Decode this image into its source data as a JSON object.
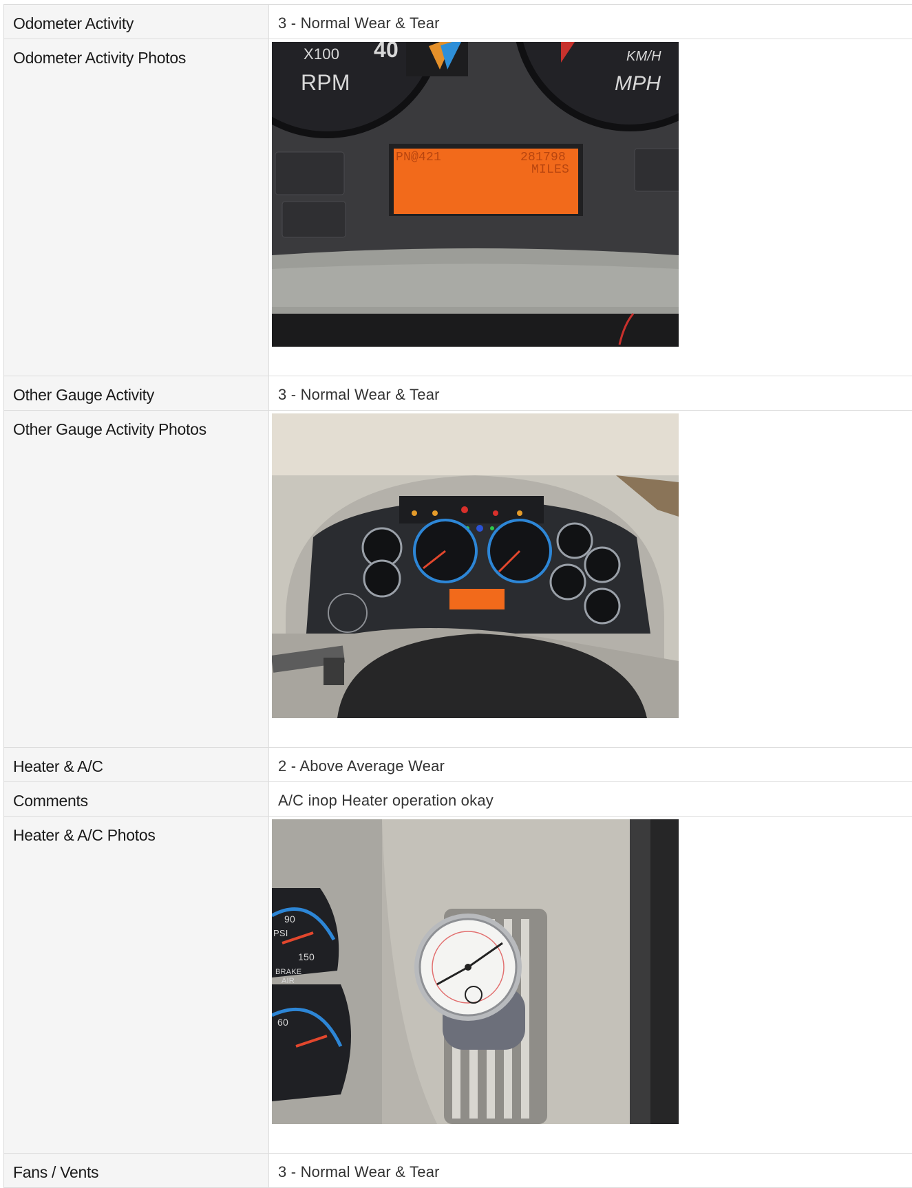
{
  "rows": [
    {
      "label": "Odometer Activity",
      "value": "3 - Normal Wear & Tear"
    },
    {
      "label": "Odometer Activity Photos",
      "photo": {
        "description_icon": "odometer-photo",
        "texts": {
          "x100": "X100",
          "rpm": "RPM",
          "forty": "40",
          "kmh": "KM/H",
          "mph": "MPH",
          "lcd_left": "PN@421",
          "lcd_right": "281798",
          "lcd_unit": "MILES"
        }
      }
    },
    {
      "label": "Other Gauge Activity",
      "value": "3 - Normal Wear & Tear"
    },
    {
      "label": "Other Gauge Activity Photos",
      "photo": {
        "description_icon": "gauge-cluster-photo"
      }
    },
    {
      "label": "Heater & A/C",
      "value": "2 - Above Average Wear"
    },
    {
      "label": "Comments",
      "value": "A/C inop Heater operation okay"
    },
    {
      "label": "Heater & A/C Photos",
      "photo": {
        "description_icon": "vent-thermometer-photo",
        "texts": {
          "psi": "PSI",
          "brake": "BRAKE",
          "air": "AIR",
          "n90": "90",
          "n150": "150",
          "n60": "60"
        }
      }
    },
    {
      "label": "Fans / Vents",
      "value": "3 - Normal Wear & Tear"
    }
  ],
  "colors": {
    "label_bg": "#f5f5f5",
    "border": "#dcdcdc",
    "lcd": "#f26a1b"
  }
}
